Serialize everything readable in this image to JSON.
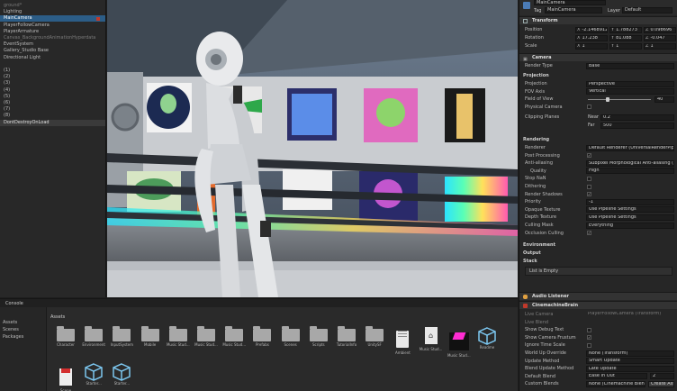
{
  "hierarchy": {
    "items": [
      {
        "label": "ground*",
        "state": "dim"
      },
      {
        "label": "Lighting",
        "state": ""
      },
      {
        "label": "MainCamera",
        "state": "sel"
      },
      {
        "label": "PlayerFollowCamera",
        "state": ""
      },
      {
        "label": "PlayerArmature",
        "state": ""
      },
      {
        "label": "Canvas_BackgroundAnimationHyperdata",
        "state": "dim"
      },
      {
        "label": "EventSystem",
        "state": ""
      },
      {
        "label": "Gallery_Studio Base",
        "state": ""
      },
      {
        "label": "Directional Light",
        "state": ""
      },
      {
        "label": "",
        "state": ""
      },
      {
        "label": "(1)",
        "state": ""
      },
      {
        "label": "(2)",
        "state": ""
      },
      {
        "label": "(3)",
        "state": ""
      },
      {
        "label": "(4)",
        "state": ""
      },
      {
        "label": "(5)",
        "state": ""
      },
      {
        "label": "(6)",
        "state": ""
      },
      {
        "label": "(7)",
        "state": ""
      },
      {
        "label": "(8)",
        "state": ""
      },
      {
        "label": "DontDestroyOnLoad",
        "state": "sel2"
      }
    ]
  },
  "inspector": {
    "object_name": "MainCamera",
    "tag_label": "Tag",
    "tag_value": "MainCamera",
    "layer_label": "Layer",
    "layer_value": "Default",
    "transform": {
      "title": "Transform",
      "rows": [
        {
          "label": "Position",
          "x": "-2.1468912",
          "y": "1.788273",
          "z": "0.098696"
        },
        {
          "label": "Rotation",
          "x": "17.238",
          "y": "81.088",
          "z": "-0.047"
        },
        {
          "label": "Scale",
          "x": "1",
          "y": "1",
          "z": "1"
        }
      ]
    },
    "camera": {
      "title": "Camera",
      "render_type_label": "Render Type",
      "render_type": "Base",
      "projection_section": "Projection",
      "projection_rows": [
        {
          "label": "Projection",
          "value": "Perspective"
        },
        {
          "label": "FOV Axis",
          "value": "Vertical"
        },
        {
          "label": "Field of View",
          "value": "40"
        },
        {
          "label": "Physical Camera",
          "value": ""
        }
      ],
      "clipping_label": "Clipping Planes",
      "near_label": "Near",
      "near": "0.2",
      "far_label": "Far",
      "far": "500",
      "rendering_section": "Rendering",
      "rendering_rows": [
        {
          "label": "Renderer",
          "value": "Default Renderer (UniversalRenderPipeline)",
          "type": "field"
        },
        {
          "label": "Post Processing",
          "value": "✓",
          "type": "check"
        },
        {
          "label": "Anti-aliasing",
          "value": "Subpixel Morphological Anti-aliasing (SMAA)",
          "type": "field"
        },
        {
          "label": "Quality",
          "value": "High",
          "type": "field",
          "indent": true
        },
        {
          "label": "Stop NaN",
          "value": "",
          "type": "check"
        },
        {
          "label": "Dithering",
          "value": "",
          "type": "check"
        },
        {
          "label": "Render Shadows",
          "value": "✓",
          "type": "check"
        },
        {
          "label": "Priority",
          "value": "-1",
          "type": "field"
        },
        {
          "label": "Opaque Texture",
          "value": "Use Pipeline Settings",
          "type": "field"
        },
        {
          "label": "Depth Texture",
          "value": "Use Pipeline Settings",
          "type": "field"
        },
        {
          "label": "Culling Mask",
          "value": "Everything",
          "type": "field"
        },
        {
          "label": "Occlusion Culling",
          "value": "✓",
          "type": "check"
        }
      ],
      "environment_section": "Environment",
      "output_section": "Output",
      "stack_section": "Stack",
      "stack_empty": "List is Empty"
    },
    "audio_listener": {
      "title": "Audio Listener"
    },
    "brain": {
      "title": "CinemachineBrain",
      "rows": [
        {
          "label": "Live Camera",
          "value": "PlayerFollowCamera (Transform)",
          "type": "plain"
        },
        {
          "label": "Live Blend",
          "value": "",
          "type": "plain"
        },
        {
          "label": "Show Debug Text",
          "value": "",
          "type": "check"
        },
        {
          "label": "Show Camera Frustum",
          "value": "✓",
          "type": "check"
        },
        {
          "label": "Ignore Time Scale",
          "value": "",
          "type": "check"
        },
        {
          "label": "World Up Override",
          "value": "None (Transform)",
          "type": "field"
        },
        {
          "label": "Update Method",
          "value": "Smart Update",
          "type": "field"
        },
        {
          "label": "Blend Update Method",
          "value": "Late Update",
          "type": "field"
        },
        {
          "label": "Default Blend",
          "value": "Ease In Out",
          "type": "field"
        },
        {
          "label": "Custom Blends",
          "value": "None (Cinemachine Blend D)",
          "type": "field"
        }
      ],
      "default_blend_num": "2",
      "create_asset": "Create Asset"
    }
  },
  "project": {
    "tab_label": "Console",
    "assets_label": "Assets",
    "tree_items": [
      "Assets",
      "Scenes",
      "Packages"
    ],
    "assets": [
      {
        "name": "Character",
        "kind": "folder"
      },
      {
        "name": "Environment",
        "kind": "folder"
      },
      {
        "name": "InputSystem",
        "kind": "folder"
      },
      {
        "name": "Mobile",
        "kind": "folder"
      },
      {
        "name": "Music Stud...",
        "kind": "folder"
      },
      {
        "name": "Music Stud...",
        "kind": "folder"
      },
      {
        "name": "Music Stud...",
        "kind": "folder"
      },
      {
        "name": "Prefabs",
        "kind": "folder"
      },
      {
        "name": "Scenes",
        "kind": "folder"
      },
      {
        "name": "Scripts",
        "kind": "folder"
      },
      {
        "name": "TutorialInfo",
        "kind": "folder"
      },
      {
        "name": "UnitySF",
        "kind": "folder"
      },
      {
        "name": "Ambient",
        "kind": "doc"
      },
      {
        "name": "Music Stud...",
        "kind": "home"
      },
      {
        "name": "Music Stud...",
        "kind": "material"
      },
      {
        "name": "Readme",
        "kind": "cube"
      },
      {
        "name": "Scene",
        "kind": "pdf"
      },
      {
        "name": "Starter...",
        "kind": "cube"
      },
      {
        "name": "Starter...",
        "kind": "cube"
      }
    ]
  },
  "colors": {
    "selection": "#2c5d87",
    "accent_blue": "#4a9fd8",
    "warning": "#e0a040"
  }
}
